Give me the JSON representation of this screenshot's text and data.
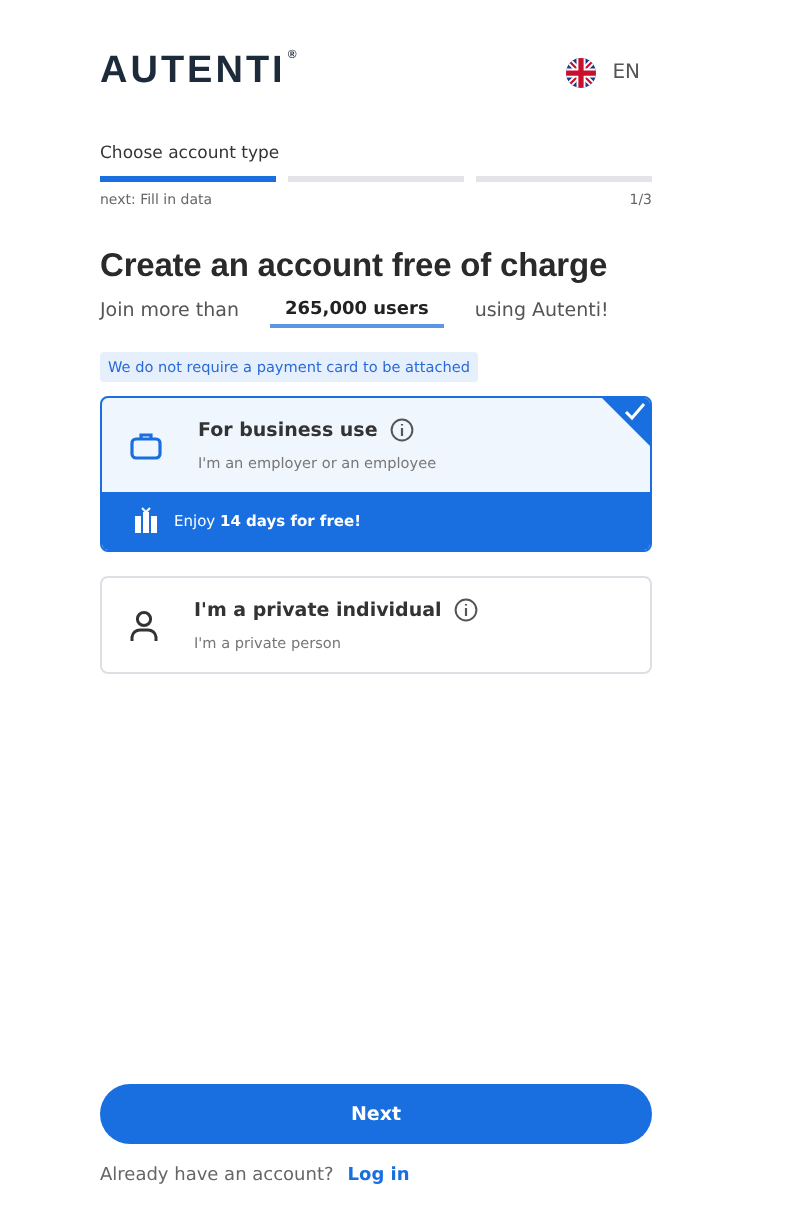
{
  "header": {
    "logo": "AUTENTI",
    "logo_mark": "®",
    "language": "EN"
  },
  "progress": {
    "label": "Choose account type",
    "next": "next: Fill in data",
    "count": "1/3",
    "segments": [
      {
        "done": true
      },
      {
        "done": false
      },
      {
        "done": false
      }
    ]
  },
  "title": "Create an account free of charge",
  "join": {
    "before": "Join more than",
    "highlight": "265,000 users",
    "after": "using Autenti!"
  },
  "note": "We do not require a payment card to be attached",
  "options": [
    {
      "kind": "business",
      "title": "For business use",
      "subtitle": "I'm an employer or an employee",
      "selected": true,
      "promo": "Enjoy **14 days for free!**"
    },
    {
      "kind": "private",
      "title": "I'm a private individual",
      "subtitle": "I'm a private person",
      "selected": false
    }
  ],
  "next_button": "Next",
  "login": {
    "question": "Already have an account?",
    "link": "Log in"
  }
}
